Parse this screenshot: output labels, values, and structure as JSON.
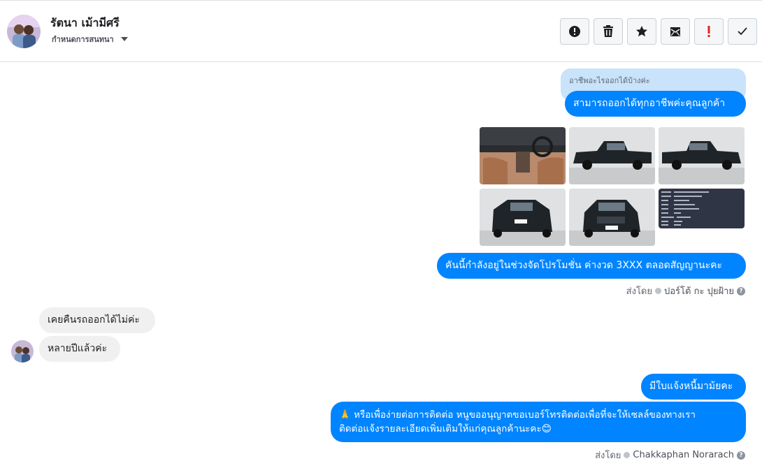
{
  "header": {
    "contact_name": "รัตนา เม้ามีศรี",
    "conversation_settings_label": "กำหนดการสนทนา",
    "actions": [
      {
        "icon": "alert-circle-icon"
      },
      {
        "icon": "trash-icon"
      },
      {
        "icon": "star-icon"
      },
      {
        "icon": "mark-unread-envelope-icon"
      },
      {
        "icon": "exclamation-icon"
      },
      {
        "icon": "checkmark-icon"
      }
    ]
  },
  "messages": {
    "quoted_text": "อาชีพอะไรออกได้บ้างค่ะ",
    "reply_1": "สามารถออกได้ทุกอาชีพค่ะคุณลูกค้า",
    "promo": "คันนี้กำลังอยู่ในช่วงจัดโปรโมชั่น ค่างวด 3XXX ตลอดสัญญานะคะ",
    "sent_by_label_1": "ส่งโดย",
    "agent_1": "ปอร์โต้ กะ ปุยฝ้าย",
    "customer_1": "เคยคืนรถออกได้ไม่ค่ะ",
    "customer_2": "หลายปีแล้วค่ะ",
    "reply_2": "มีใบแจ้งหนี้มาม้ยคะ",
    "reply_3_line1": "🙏 หรือเพื่อง่ายต่อการติดต่อ หนูขออนุญาตขอเบอร์โทรติดต่อเพื่อที่จะให้เซลล์ของทางเรา",
    "reply_3_line2": "ติดต่อแจ้งรายละเอียดเพิ่มเติมให้แก่คุณลูกค้านะคะ😊",
    "sent_by_label_2": "ส่งโดย",
    "agent_2": "Chakkaphan Norarach"
  },
  "photos": [
    {
      "name": "interior"
    },
    {
      "name": "side-left"
    },
    {
      "name": "side-right"
    },
    {
      "name": "rear"
    },
    {
      "name": "front"
    },
    {
      "name": "spec-sheet"
    }
  ],
  "colors": {
    "outgoing_bubble": "#0084ff",
    "incoming_bubble": "#f1f0f0",
    "quoted_bubble": "#c9e3fb",
    "truck": "#1f2428",
    "spec_bg": "#2f3545"
  }
}
